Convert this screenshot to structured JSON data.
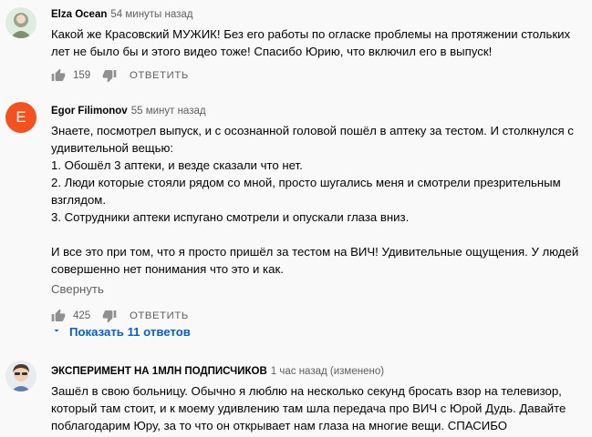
{
  "comments": [
    {
      "author": "Elza Ocean",
      "time": "54 минуты назад",
      "text": "Какой же Красовский МУЖИК! Без его работы по огласке проблемы на протяжении стольких\nлет не было бы и этого видео тоже! Спасибо Юрию, что включил его в выпуск!",
      "likes": "159",
      "reply_label": "ОТВЕТИТЬ"
    },
    {
      "author": "Egor Filimonov",
      "time": "55 минут назад",
      "avatar_letter": "E",
      "avatar_color": "#f4511e",
      "text": "Знаете, посмотрел выпуск, и с осознанной головой пошёл в аптеку за тестом. И столкнулся с\nудивительной вещью:\n1. Обошёл 3 аптеки, и везде сказали что нет.\n2. Люди которые стояли рядом со мной, просто шугались меня и смотрели презрительным\nвзглядом.\n3. Сотрудники аптеки испугано смотрели и опускали глаза вниз.\n\nИ все это при том, что я просто пришёл за тестом на ВИЧ! Удивительные ощущения. У людей\nсовершенно нет понимания что это и как.",
      "collapse_label": "Свернуть",
      "likes": "425",
      "reply_label": "ОТВЕТИТЬ",
      "show_replies_label": "Показать 11 ответов",
      "link_color": "#065fd4"
    },
    {
      "author": "ЭКСПЕРИМЕНТ НА 1МЛН ПОДПИСЧИКОВ",
      "time": "1 час назад (изменено)",
      "text": "Зашёл в свою больницу. Обычно я люблю на несколько секунд бросать взор на телевизор,\nкоторый там стоит, и к моему удивлению там шла передача про ВИЧ с Юрой Дудь. Давайте\nпоблагодарим Юру, за то что он открывает нам глаза на многие вещи. СПАСИБО"
    }
  ]
}
